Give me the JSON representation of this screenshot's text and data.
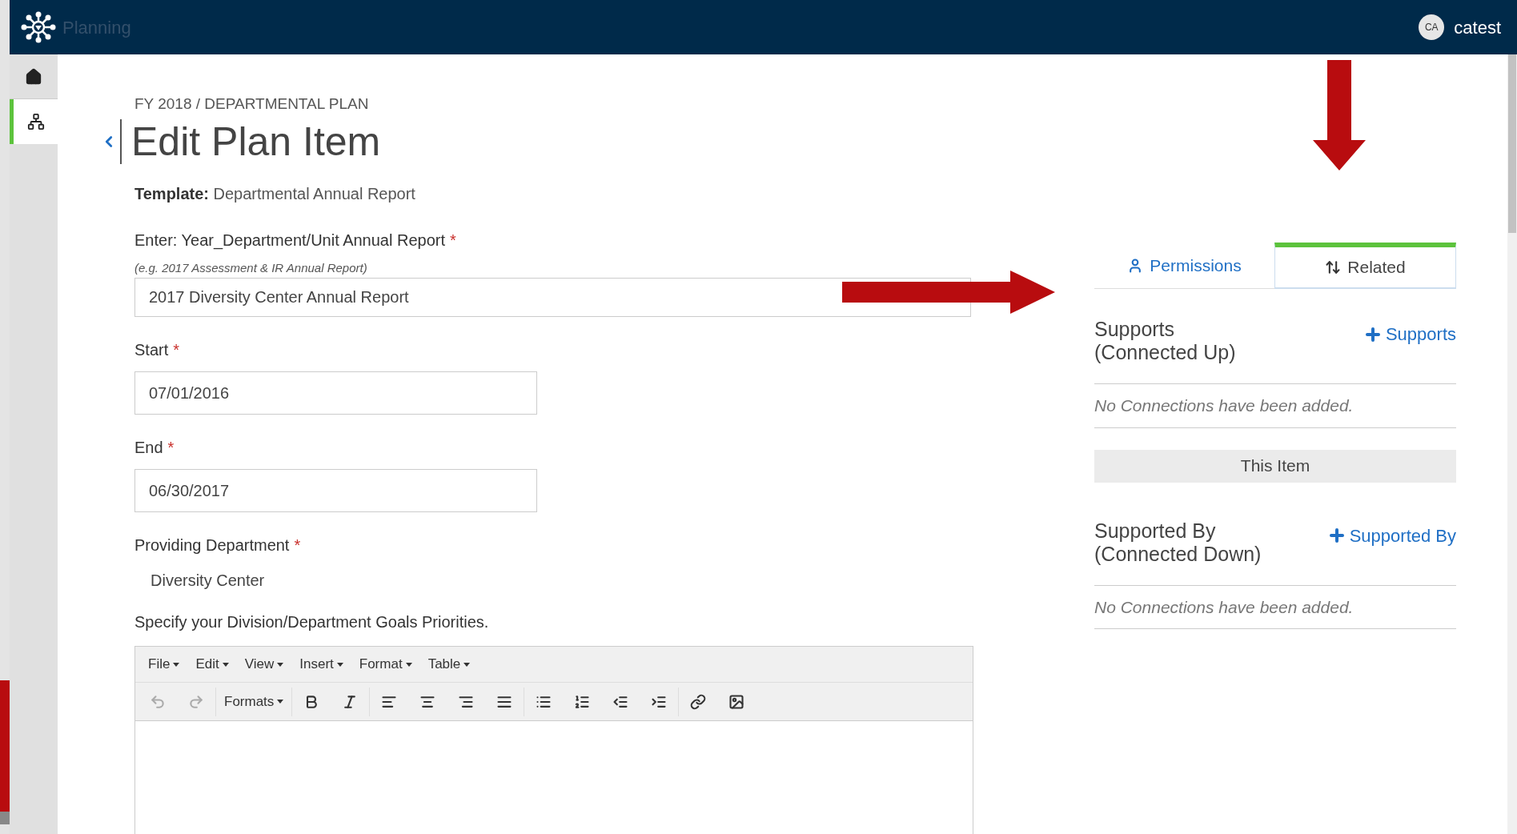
{
  "top_bar": {
    "app_name": "Planning",
    "user": {
      "initials": "CA",
      "name": "catest"
    }
  },
  "sidebar": {
    "items": [
      {
        "kind": "home",
        "selected": false
      },
      {
        "kind": "hierarchy",
        "selected": true
      }
    ]
  },
  "breadcrumb": "FY 2018 / DEPARTMENTAL PLAN",
  "title": "Edit Plan Item",
  "template": {
    "label": "Template:",
    "value": "Departmental Annual Report"
  },
  "fields": [
    {
      "kind": "wide",
      "label": "Enter: Year_Department/Unit Annual Report",
      "required_mark": "*",
      "hint": "(e.g. 2017 Assessment & IR Annual Report)",
      "value": "2017 Diversity Center Annual Report"
    },
    {
      "kind": "short",
      "label": "Start",
      "required_mark": "*",
      "value": "07/01/2016"
    },
    {
      "kind": "short",
      "label": "End",
      "required_mark": "*",
      "value": "06/30/2017"
    },
    {
      "kind": "static",
      "label": "Providing Department",
      "required_mark": "*",
      "value": "Diversity Center"
    }
  ],
  "editor": {
    "label": "Specify your Division/Department Goals Priorities.",
    "menus": [
      "File",
      "Edit",
      "View",
      "Insert",
      "Format",
      "Table"
    ],
    "toolbar": [
      [
        {
          "kind": "undo",
          "disabled": true
        },
        {
          "kind": "redo",
          "disabled": true
        }
      ],
      [
        {
          "kind": "dropdown",
          "label": "Formats"
        }
      ],
      [
        {
          "kind": "bold"
        },
        {
          "kind": "italic"
        }
      ],
      [
        {
          "kind": "align-left"
        },
        {
          "kind": "align-center"
        },
        {
          "kind": "align-right"
        },
        {
          "kind": "align-justify"
        }
      ],
      [
        {
          "kind": "bullets"
        },
        {
          "kind": "numbers"
        },
        {
          "kind": "outdent"
        },
        {
          "kind": "indent"
        }
      ],
      [
        {
          "kind": "link"
        },
        {
          "kind": "image"
        }
      ]
    ]
  },
  "tabs": [
    {
      "kind": "permissions",
      "label": "Permissions",
      "selected": false
    },
    {
      "kind": "related",
      "label": "Related",
      "selected": true
    }
  ],
  "connections": {
    "up": {
      "title": "Supports",
      "subtitle": "(Connected Up)",
      "add_link": "Supports",
      "empty": "No Connections have been added."
    },
    "center": "This Item",
    "down": {
      "title": "Supported By",
      "subtitle": "(Connected Down)",
      "add_link": "Supported By",
      "empty": "No Connections have been added."
    }
  }
}
